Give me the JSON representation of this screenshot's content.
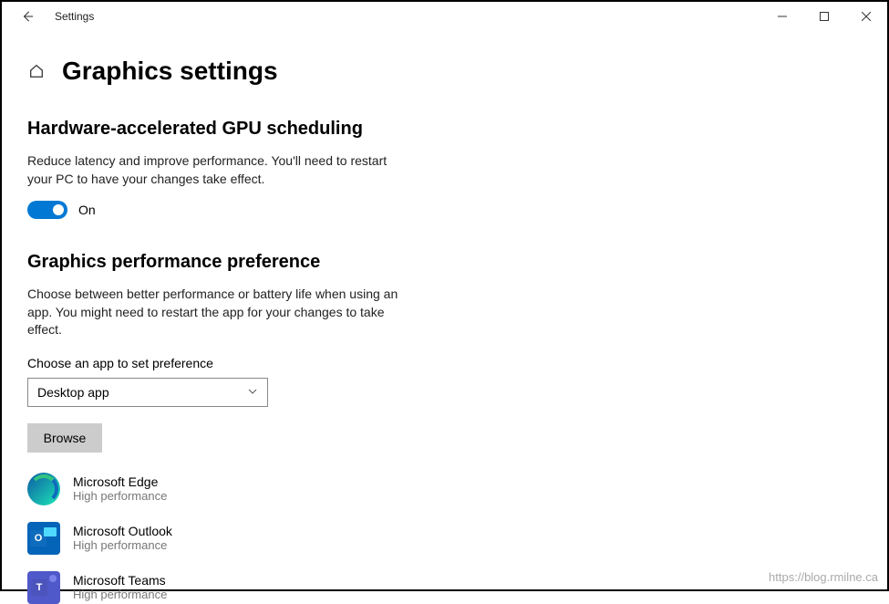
{
  "titlebar": {
    "title": "Settings"
  },
  "page": {
    "title": "Graphics settings"
  },
  "gpu_section": {
    "title": "Hardware-accelerated GPU scheduling",
    "description": "Reduce latency and improve performance. You'll need to restart your PC to have your changes take effect.",
    "toggle_state": "On"
  },
  "perf_section": {
    "title": "Graphics performance preference",
    "description": "Choose between better performance or battery life when using an app. You might need to restart the app for your changes to take effect.",
    "choose_label": "Choose an app to set preference",
    "dropdown_value": "Desktop app",
    "browse_label": "Browse"
  },
  "apps": [
    {
      "name": "Microsoft Edge",
      "perf": "High performance",
      "icon": "edge"
    },
    {
      "name": "Microsoft Outlook",
      "perf": "High performance",
      "icon": "outlook"
    },
    {
      "name": "Microsoft Teams",
      "perf": "High performance",
      "icon": "teams"
    }
  ],
  "watermark": "https://blog.rmilne.ca"
}
